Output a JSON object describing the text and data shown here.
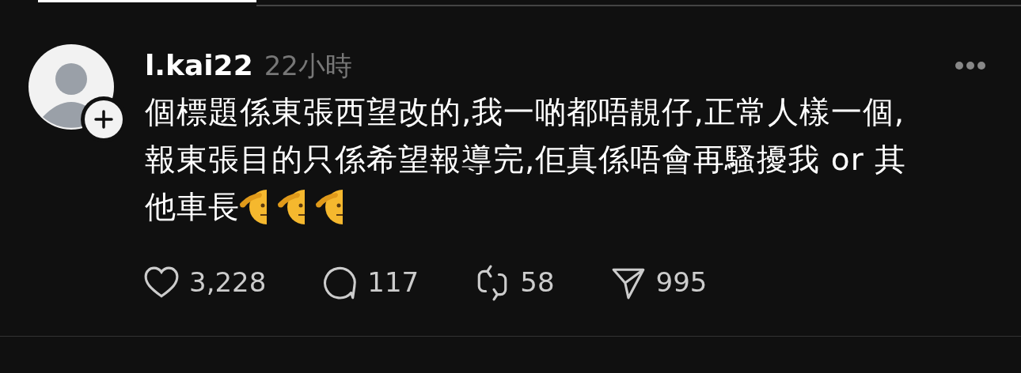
{
  "post": {
    "username": "l.kai22",
    "time": "22小時",
    "body_lines": [
      "個標題係東張西望改的,我一啲都唔靚仔,正常人樣一個,",
      "報東張目的只係希望報導完,佢真係唔會再騷擾我 or 其",
      "他車長"
    ],
    "emojis": [
      {
        "kind": "salute"
      },
      {
        "kind": "salute"
      },
      {
        "kind": "salute"
      }
    ],
    "actions": [
      {
        "kind": "like",
        "count": "3,228"
      },
      {
        "kind": "reply",
        "count": "117"
      },
      {
        "kind": "repost",
        "count": "58"
      },
      {
        "kind": "share",
        "count": "995"
      }
    ]
  }
}
